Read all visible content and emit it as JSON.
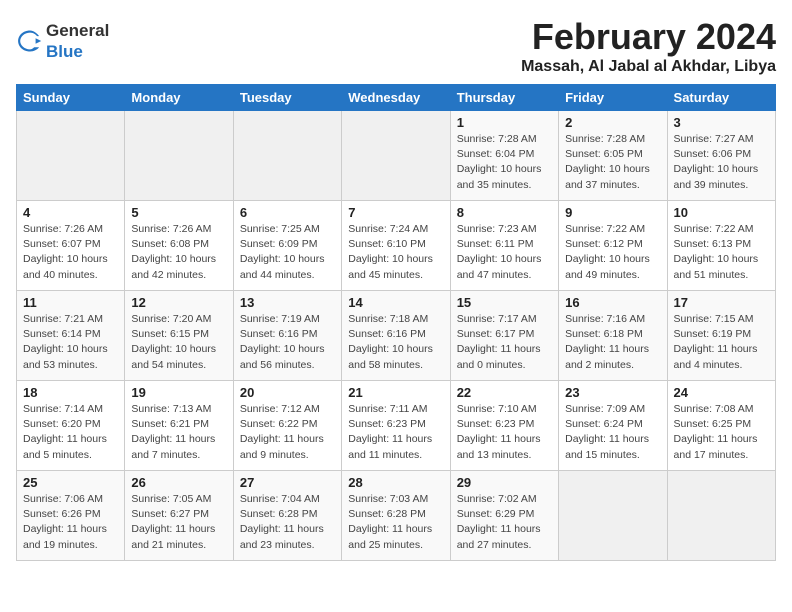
{
  "logo": {
    "general": "General",
    "blue": "Blue"
  },
  "header": {
    "month": "February 2024",
    "location": "Massah, Al Jabal al Akhdar, Libya"
  },
  "weekdays": [
    "Sunday",
    "Monday",
    "Tuesday",
    "Wednesday",
    "Thursday",
    "Friday",
    "Saturday"
  ],
  "weeks": [
    [
      {
        "day": "",
        "info": ""
      },
      {
        "day": "",
        "info": ""
      },
      {
        "day": "",
        "info": ""
      },
      {
        "day": "",
        "info": ""
      },
      {
        "day": "1",
        "info": "Sunrise: 7:28 AM\nSunset: 6:04 PM\nDaylight: 10 hours\nand 35 minutes."
      },
      {
        "day": "2",
        "info": "Sunrise: 7:28 AM\nSunset: 6:05 PM\nDaylight: 10 hours\nand 37 minutes."
      },
      {
        "day": "3",
        "info": "Sunrise: 7:27 AM\nSunset: 6:06 PM\nDaylight: 10 hours\nand 39 minutes."
      }
    ],
    [
      {
        "day": "4",
        "info": "Sunrise: 7:26 AM\nSunset: 6:07 PM\nDaylight: 10 hours\nand 40 minutes."
      },
      {
        "day": "5",
        "info": "Sunrise: 7:26 AM\nSunset: 6:08 PM\nDaylight: 10 hours\nand 42 minutes."
      },
      {
        "day": "6",
        "info": "Sunrise: 7:25 AM\nSunset: 6:09 PM\nDaylight: 10 hours\nand 44 minutes."
      },
      {
        "day": "7",
        "info": "Sunrise: 7:24 AM\nSunset: 6:10 PM\nDaylight: 10 hours\nand 45 minutes."
      },
      {
        "day": "8",
        "info": "Sunrise: 7:23 AM\nSunset: 6:11 PM\nDaylight: 10 hours\nand 47 minutes."
      },
      {
        "day": "9",
        "info": "Sunrise: 7:22 AM\nSunset: 6:12 PM\nDaylight: 10 hours\nand 49 minutes."
      },
      {
        "day": "10",
        "info": "Sunrise: 7:22 AM\nSunset: 6:13 PM\nDaylight: 10 hours\nand 51 minutes."
      }
    ],
    [
      {
        "day": "11",
        "info": "Sunrise: 7:21 AM\nSunset: 6:14 PM\nDaylight: 10 hours\nand 53 minutes."
      },
      {
        "day": "12",
        "info": "Sunrise: 7:20 AM\nSunset: 6:15 PM\nDaylight: 10 hours\nand 54 minutes."
      },
      {
        "day": "13",
        "info": "Sunrise: 7:19 AM\nSunset: 6:16 PM\nDaylight: 10 hours\nand 56 minutes."
      },
      {
        "day": "14",
        "info": "Sunrise: 7:18 AM\nSunset: 6:16 PM\nDaylight: 10 hours\nand 58 minutes."
      },
      {
        "day": "15",
        "info": "Sunrise: 7:17 AM\nSunset: 6:17 PM\nDaylight: 11 hours\nand 0 minutes."
      },
      {
        "day": "16",
        "info": "Sunrise: 7:16 AM\nSunset: 6:18 PM\nDaylight: 11 hours\nand 2 minutes."
      },
      {
        "day": "17",
        "info": "Sunrise: 7:15 AM\nSunset: 6:19 PM\nDaylight: 11 hours\nand 4 minutes."
      }
    ],
    [
      {
        "day": "18",
        "info": "Sunrise: 7:14 AM\nSunset: 6:20 PM\nDaylight: 11 hours\nand 5 minutes."
      },
      {
        "day": "19",
        "info": "Sunrise: 7:13 AM\nSunset: 6:21 PM\nDaylight: 11 hours\nand 7 minutes."
      },
      {
        "day": "20",
        "info": "Sunrise: 7:12 AM\nSunset: 6:22 PM\nDaylight: 11 hours\nand 9 minutes."
      },
      {
        "day": "21",
        "info": "Sunrise: 7:11 AM\nSunset: 6:23 PM\nDaylight: 11 hours\nand 11 minutes."
      },
      {
        "day": "22",
        "info": "Sunrise: 7:10 AM\nSunset: 6:23 PM\nDaylight: 11 hours\nand 13 minutes."
      },
      {
        "day": "23",
        "info": "Sunrise: 7:09 AM\nSunset: 6:24 PM\nDaylight: 11 hours\nand 15 minutes."
      },
      {
        "day": "24",
        "info": "Sunrise: 7:08 AM\nSunset: 6:25 PM\nDaylight: 11 hours\nand 17 minutes."
      }
    ],
    [
      {
        "day": "25",
        "info": "Sunrise: 7:06 AM\nSunset: 6:26 PM\nDaylight: 11 hours\nand 19 minutes."
      },
      {
        "day": "26",
        "info": "Sunrise: 7:05 AM\nSunset: 6:27 PM\nDaylight: 11 hours\nand 21 minutes."
      },
      {
        "day": "27",
        "info": "Sunrise: 7:04 AM\nSunset: 6:28 PM\nDaylight: 11 hours\nand 23 minutes."
      },
      {
        "day": "28",
        "info": "Sunrise: 7:03 AM\nSunset: 6:28 PM\nDaylight: 11 hours\nand 25 minutes."
      },
      {
        "day": "29",
        "info": "Sunrise: 7:02 AM\nSunset: 6:29 PM\nDaylight: 11 hours\nand 27 minutes."
      },
      {
        "day": "",
        "info": ""
      },
      {
        "day": "",
        "info": ""
      }
    ]
  ]
}
